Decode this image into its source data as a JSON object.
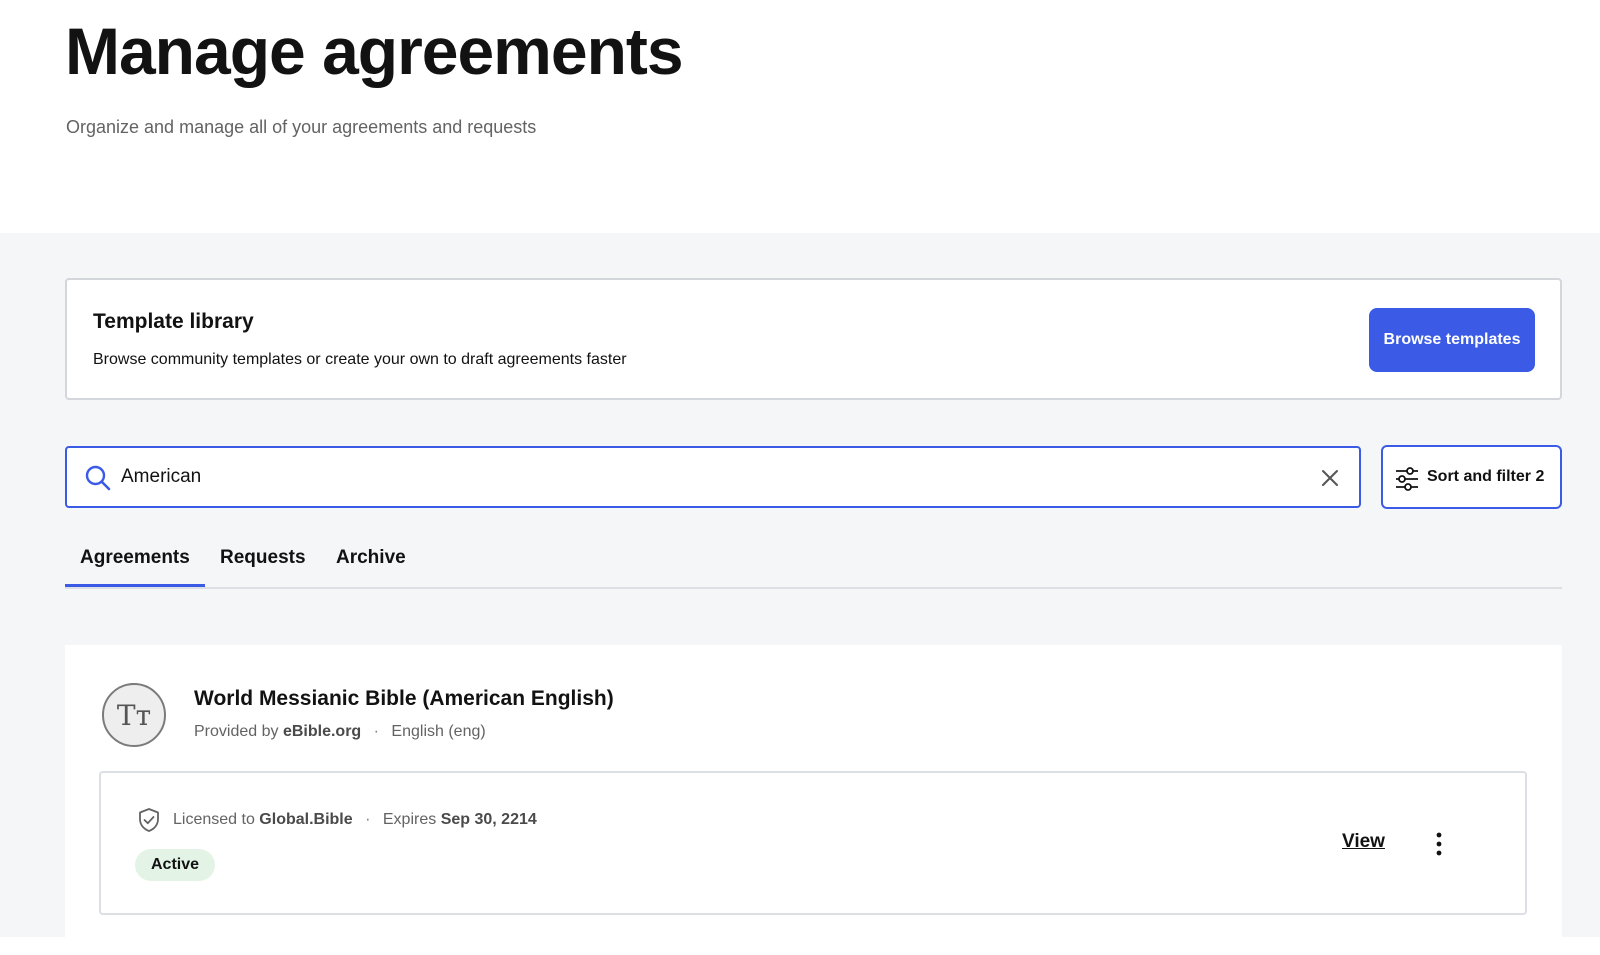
{
  "header": {
    "title": "Manage agreements",
    "subtitle": "Organize and manage all of your agreements and requests"
  },
  "template_library": {
    "title": "Template library",
    "description": "Browse community templates or create your own to draft agreements faster",
    "button_label": "Browse templates"
  },
  "search": {
    "value": "American",
    "icon": "search-icon",
    "clear_icon": "close-icon"
  },
  "sort_filter": {
    "label": "Sort and filter 2",
    "icon": "sliders-icon"
  },
  "tabs": [
    {
      "label": "Agreements",
      "active": true
    },
    {
      "label": "Requests",
      "active": false
    },
    {
      "label": "Archive",
      "active": false
    }
  ],
  "item": {
    "avatar_text": "Tт",
    "title": "World Messianic Bible (American English)",
    "provided_by_prefix": "Provided by",
    "provider": "eBible.org",
    "language": "English (eng)",
    "license": {
      "licensed_to_prefix": "Licensed to",
      "licensee": "Global.Bible",
      "expires_prefix": "Expires",
      "expires_date": "Sep 30, 2214",
      "status": "Active",
      "view_label": "View"
    }
  },
  "colors": {
    "accent": "#3b5be6",
    "badge_bg": "#e3f4e6",
    "page_bg": "#f5f6f7"
  }
}
